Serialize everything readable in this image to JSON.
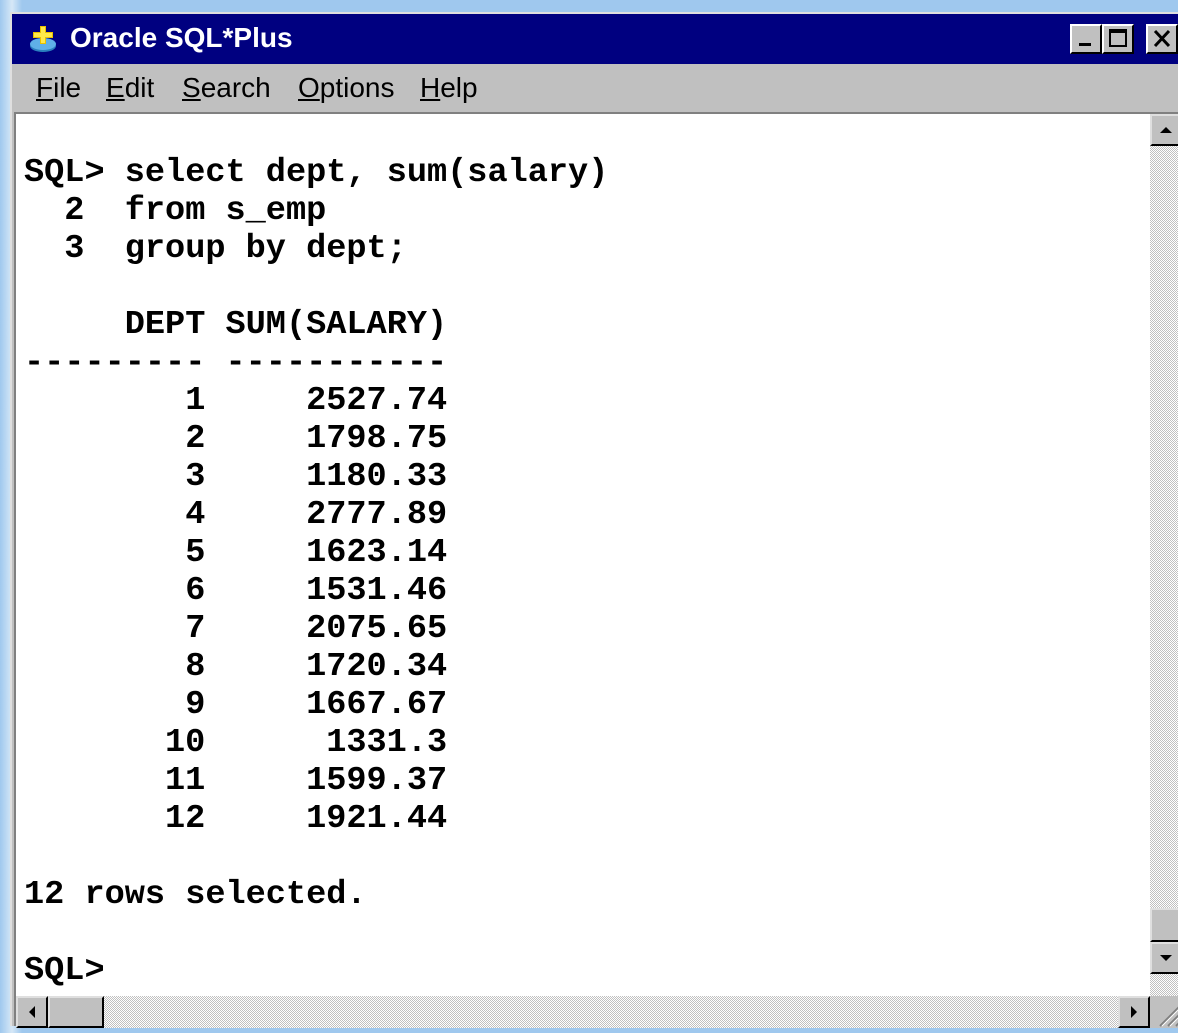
{
  "window": {
    "title": "Oracle SQL*Plus",
    "icon": "oracle-app-icon"
  },
  "menu": [
    {
      "label": "File",
      "mnemonic": "F",
      "rest": "ile"
    },
    {
      "label": "Edit",
      "mnemonic": "E",
      "rest": "dit"
    },
    {
      "label": "Search",
      "mnemonic": "S",
      "rest": "earch"
    },
    {
      "label": "Options",
      "mnemonic": "O",
      "rest": "ptions"
    },
    {
      "label": "Help",
      "mnemonic": "H",
      "rest": "elp"
    }
  ],
  "console": {
    "query_lines": [
      "SQL> select dept, sum(salary)",
      "  2  from s_emp",
      "  3  group by dept;"
    ],
    "column_header": "     DEPT SUM(SALARY)",
    "column_separator": "--------- -----------",
    "columns": [
      "DEPT",
      "SUM(SALARY)"
    ],
    "rows": [
      {
        "dept": "1",
        "sum": "2527.74"
      },
      {
        "dept": "2",
        "sum": "1798.75"
      },
      {
        "dept": "3",
        "sum": "1180.33"
      },
      {
        "dept": "4",
        "sum": "2777.89"
      },
      {
        "dept": "5",
        "sum": "1623.14"
      },
      {
        "dept": "6",
        "sum": "1531.46"
      },
      {
        "dept": "7",
        "sum": "2075.65"
      },
      {
        "dept": "8",
        "sum": "1720.34"
      },
      {
        "dept": "9",
        "sum": "1667.67"
      },
      {
        "dept": "10",
        "sum": "1331.3"
      },
      {
        "dept": "11",
        "sum": "1599.37"
      },
      {
        "dept": "12",
        "sum": "1921.44"
      }
    ],
    "status": "12 rows selected.",
    "prompt": "SQL>"
  },
  "colors": {
    "titlebar": "#000080",
    "chrome": "#c0c0c0",
    "console_bg": "#ffffff",
    "text": "#000000"
  }
}
